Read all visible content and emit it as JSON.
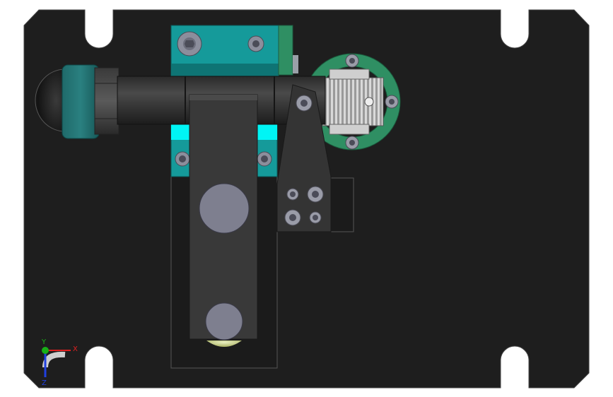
{
  "view": {
    "background_color": "#ffffff",
    "plate_color": "#1e1e1e",
    "teal_color": "#159a9a",
    "cyan_highlight": "#00f5f5",
    "green_ring_color": "#2f8f63",
    "steel_color": "#3a3a3a",
    "screw_color": "#9a9ca8",
    "bolt_face_color": "#7e7f8f"
  },
  "triad": {
    "x_label": "X",
    "y_label": "Y",
    "z_label": "Z",
    "x_color": "#e02020",
    "y_color": "#18b018",
    "z_color": "#2040e0"
  }
}
